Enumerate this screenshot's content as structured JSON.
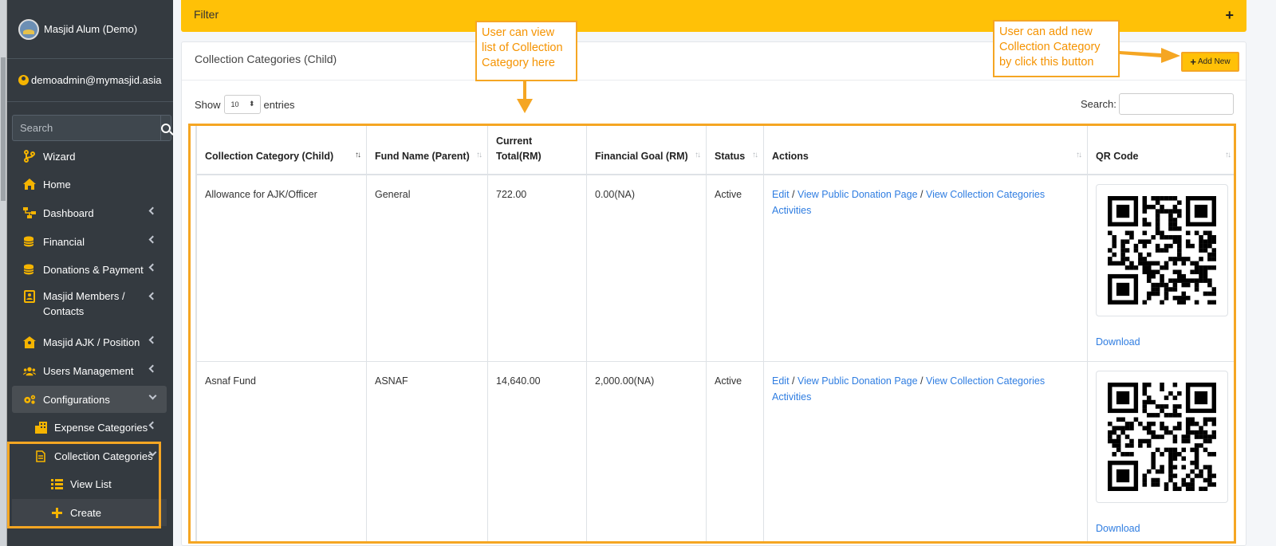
{
  "sidebar": {
    "brand": "Masjid Alum (Demo)",
    "user_email": "demoadmin@mymasjid.asia",
    "search_placeholder": "Search",
    "items": [
      {
        "label": "Wizard",
        "icon": "wizard-icon"
      },
      {
        "label": "Home",
        "icon": "home-icon"
      },
      {
        "label": "Dashboard",
        "icon": "dashboard-icon"
      },
      {
        "label": "Financial",
        "icon": "financial-icon"
      },
      {
        "label": "Donations & Payment",
        "icon": "donation-icon"
      },
      {
        "label": "Masjid Members / Contacts",
        "icon": "members-icon"
      },
      {
        "label": "Masjid AJK / Position",
        "icon": "position-icon"
      },
      {
        "label": "Users Management",
        "icon": "users-icon"
      },
      {
        "label": "Configurations",
        "icon": "gears-icon"
      },
      {
        "label": "Expense Categories",
        "icon": "expense-icon"
      },
      {
        "label": "Collection Categories",
        "icon": "file-icon"
      },
      {
        "label": "View List",
        "icon": "list-icon"
      },
      {
        "label": "Create",
        "icon": "plus-icon"
      }
    ]
  },
  "filter": {
    "title": "Filter",
    "toggle": "+"
  },
  "card": {
    "title": "Collection Categories (Child)",
    "add_new": "Add New",
    "show_label": "Show",
    "entries_label": "entries",
    "page_length": "10",
    "search_label": "Search:"
  },
  "table": {
    "headers": [
      "Collection Category (Child)",
      "Fund Name (Parent)",
      "Current Total(RM)",
      "Financial Goal (RM)",
      "Status",
      "Actions",
      "QR Code"
    ],
    "rows": [
      {
        "category": "Allowance for AJK/Officer",
        "fund": "General",
        "total": "722.00",
        "goal": "0.00(NA)",
        "status": "Active"
      },
      {
        "category": "Asnaf Fund",
        "fund": "ASNAF",
        "total": "14,640.00",
        "goal": "2,000.00(NA)",
        "status": "Active"
      }
    ],
    "action_edit": "Edit",
    "action_public": "View Public Donation Page",
    "action_activities": "View Collection Categories Activities",
    "download": "Download"
  },
  "callouts": {
    "list": "User can view list of Collection Category here",
    "add": "User can add new Collection Category by click this button"
  },
  "colors": {
    "accent": "#ffc107",
    "highlight": "#f5a623",
    "sidebar": "#343a40",
    "link": "#2f7de1"
  }
}
